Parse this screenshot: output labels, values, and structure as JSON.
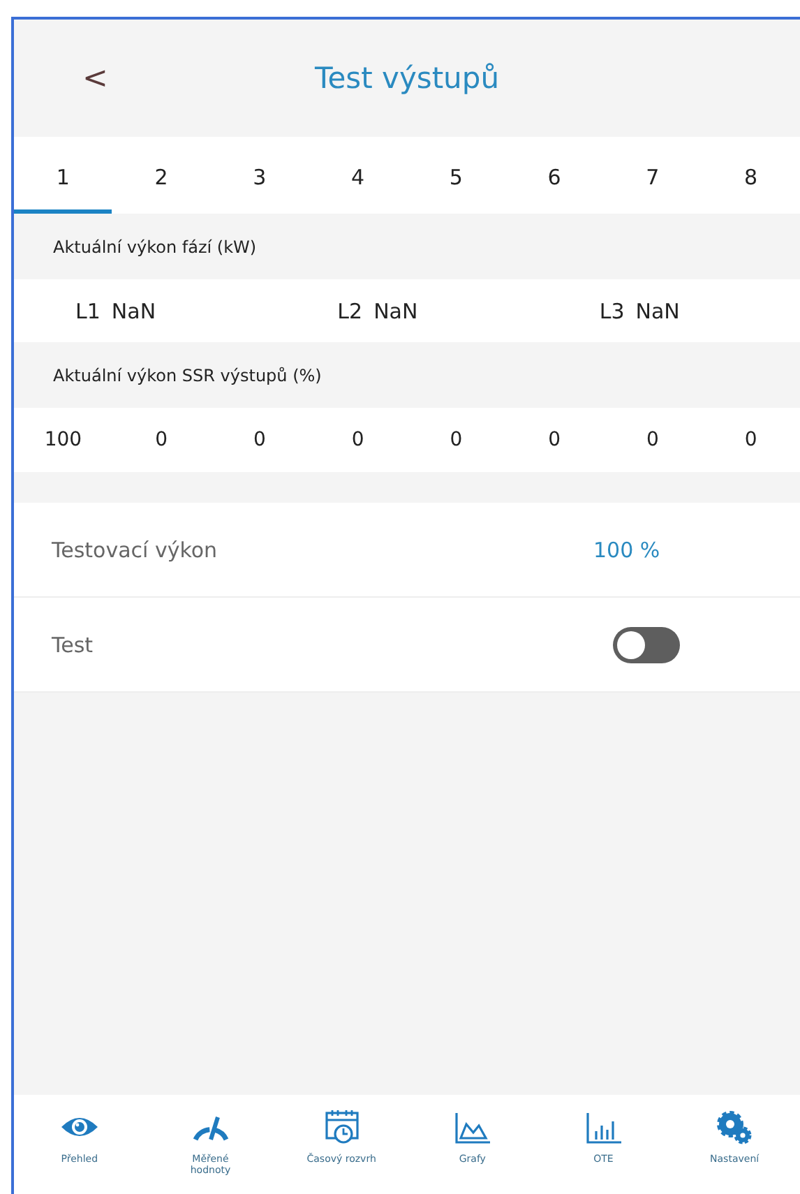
{
  "header": {
    "back": "<",
    "title": "Test výstupů"
  },
  "tabs": [
    {
      "label": "1",
      "selected": true
    },
    {
      "label": "2",
      "selected": false
    },
    {
      "label": "3",
      "selected": false
    },
    {
      "label": "4",
      "selected": false
    },
    {
      "label": "5",
      "selected": false
    },
    {
      "label": "6",
      "selected": false
    },
    {
      "label": "7",
      "selected": false
    },
    {
      "label": "8",
      "selected": false
    }
  ],
  "phases": {
    "title": "Aktuální výkon fází (kW)",
    "items": [
      {
        "label": "L1",
        "value": "NaN"
      },
      {
        "label": "L2",
        "value": "NaN"
      },
      {
        "label": "L3",
        "value": "NaN"
      }
    ]
  },
  "ssr": {
    "title": "Aktuální výkon SSR výstupů (%)",
    "values": [
      "100",
      "0",
      "0",
      "0",
      "0",
      "0",
      "0",
      "0"
    ]
  },
  "settings": [
    {
      "kind": "value",
      "label": "Testovací výkon",
      "value": "100 %"
    },
    {
      "kind": "toggle",
      "label": "Test",
      "on": false
    }
  ],
  "nav": [
    {
      "label": "Přehled"
    },
    {
      "label": "Měřené hodnoty"
    },
    {
      "label": "Časový rozvrh"
    },
    {
      "label": "Grafy"
    },
    {
      "label": "OTE"
    },
    {
      "label": "Nastavení"
    }
  ]
}
